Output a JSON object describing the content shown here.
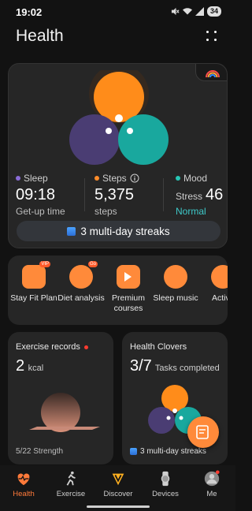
{
  "status": {
    "time": "19:02",
    "battery": "34",
    "icons": [
      "mute-icon",
      "wifi-icon",
      "signal-icon",
      "battery-icon"
    ]
  },
  "header": {
    "title": "Health",
    "menu_icon": "grid-dots-icon"
  },
  "hero": {
    "metrics": {
      "sleep": {
        "label": "Sleep",
        "value": "09:18",
        "sub": "Get-up time",
        "color": "#8a6cd8"
      },
      "steps": {
        "label": "Steps",
        "value": "5,375",
        "sub": "steps",
        "color": "#ff8c2a"
      },
      "mood": {
        "label": "Mood",
        "stress_label": "Stress",
        "stress_value": "46",
        "status": "Normal",
        "color": "#27c6b5",
        "status_color": "#3ec9c9"
      }
    },
    "streak": "3 multi-day streaks",
    "clover_colors": {
      "steps": "#ff8c1a",
      "sleep": "#4a3d73",
      "mood": "#19a89e"
    }
  },
  "services": [
    {
      "label": "Stay Fit Plan",
      "icon": "fitness-plan-icon",
      "badge": "VIP"
    },
    {
      "label": "Diet analysis",
      "icon": "diet-clock-icon",
      "badge": "Go"
    },
    {
      "label": "Premium courses",
      "icon": "video-course-icon"
    },
    {
      "label": "Sleep music",
      "icon": "moon-music-icon"
    },
    {
      "label": "Activit",
      "icon": "activity-icon"
    }
  ],
  "exercise_card": {
    "title": "Exercise records",
    "value": "2",
    "unit": "kcal",
    "footer": "5/22 Strength"
  },
  "clovers_card": {
    "title": "Health Clovers",
    "value": "3/7",
    "sub": "Tasks completed",
    "streak": "3 multi-day streaks"
  },
  "nav": [
    {
      "label": "Health",
      "icon": "heart-pulse-icon",
      "active": true
    },
    {
      "label": "Exercise",
      "icon": "running-icon",
      "active": false
    },
    {
      "label": "Discover",
      "icon": "vip-v-icon",
      "active": false
    },
    {
      "label": "Devices",
      "icon": "watch-icon",
      "active": false
    },
    {
      "label": "Me",
      "icon": "profile-icon",
      "active": false
    }
  ],
  "colors": {
    "accent": "#ff7a3a",
    "background": "#121212",
    "card": "#262626"
  }
}
